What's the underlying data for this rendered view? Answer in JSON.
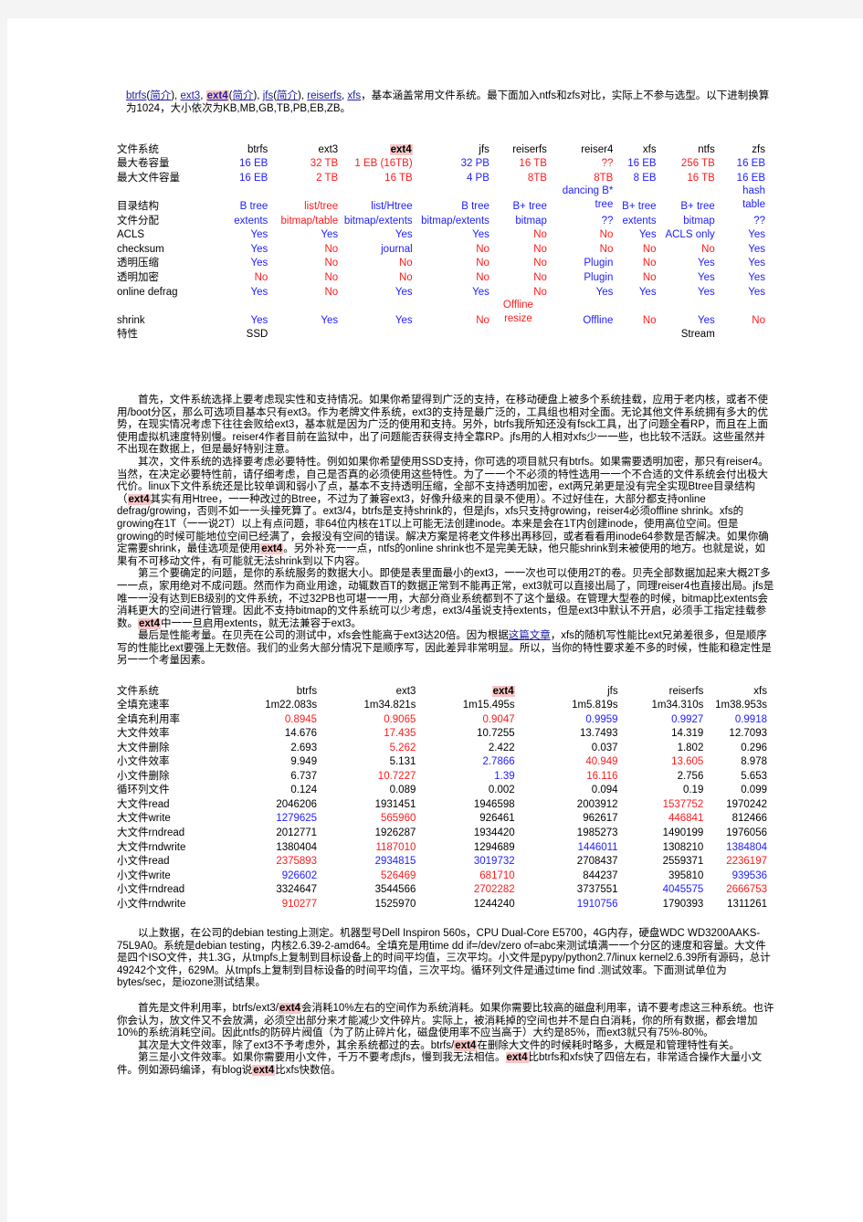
{
  "intro": {
    "links": [
      {
        "text": "btrfs",
        "kind": "link"
      },
      {
        "text": "(",
        "kind": "plain"
      },
      {
        "text": "简介",
        "kind": "link"
      },
      {
        "text": "), ",
        "kind": "plain"
      },
      {
        "text": "ext3",
        "kind": "link"
      },
      {
        "text": ", ",
        "kind": "plain"
      },
      {
        "text": "ext4",
        "kind": "link-hl"
      },
      {
        "text": "(",
        "kind": "plain"
      },
      {
        "text": "简介",
        "kind": "link"
      },
      {
        "text": "), ",
        "kind": "plain"
      },
      {
        "text": "jfs",
        "kind": "link"
      },
      {
        "text": "(",
        "kind": "plain"
      },
      {
        "text": "简介",
        "kind": "link"
      },
      {
        "text": "), ",
        "kind": "plain"
      },
      {
        "text": "reiserfs",
        "kind": "link"
      },
      {
        "text": ", ",
        "kind": "plain"
      },
      {
        "text": "xfs",
        "kind": "link"
      }
    ],
    "text": "，基本涵盖常用文件系统。最下面加入ntfs和zfs对比，实际上不参与选型。以下进制换算为1024，大小依次为KB,MB,GB,TB,PB,EB,ZB。"
  },
  "feature_table": {
    "header": [
      "文件系统",
      "btrfs",
      "ext3",
      "ext4",
      "jfs",
      "reiserfs",
      "reiser4",
      "xfs",
      "ntfs",
      "zfs"
    ],
    "rows": [
      {
        "label": "最大卷容量",
        "cells": [
          [
            "16 EB",
            "b"
          ],
          [
            "32 TB",
            "r"
          ],
          [
            "1 EB (16TB)",
            "r"
          ],
          [
            "32 PB",
            "b"
          ],
          [
            "16 TB",
            "r"
          ],
          [
            "??",
            "r"
          ],
          [
            "16 EB",
            "b"
          ],
          [
            "256 TB",
            "r"
          ],
          [
            "16 EB",
            "b"
          ]
        ]
      },
      {
        "label": "最大文件容量",
        "cells": [
          [
            "16 EB",
            "b"
          ],
          [
            "2 TB",
            "r"
          ],
          [
            "16 TB",
            "r"
          ],
          [
            "4 PB",
            "b"
          ],
          [
            "8TB",
            "r"
          ],
          [
            "8TB",
            "r"
          ],
          [
            "8 EB",
            "b"
          ],
          [
            "16 TB",
            "r"
          ],
          [
            "16 EB",
            "b"
          ]
        ]
      },
      {
        "label": "目录结构",
        "tall": true,
        "cells": [
          [
            "B tree",
            "b"
          ],
          [
            "list/tree",
            "r"
          ],
          [
            "list/Htree",
            "b"
          ],
          [
            "B tree",
            "b"
          ],
          [
            "B+ tree",
            "b"
          ],
          [
            "dancing B* tree",
            "b"
          ],
          [
            "B+ tree",
            "b"
          ],
          [
            "B+ tree",
            "b"
          ],
          [
            "hash table",
            "b"
          ]
        ]
      },
      {
        "label": "文件分配",
        "cells": [
          [
            "extents",
            "b"
          ],
          [
            "bitmap/table",
            "r"
          ],
          [
            "bitmap/extents",
            "b"
          ],
          [
            "bitmap/extents",
            "b"
          ],
          [
            "bitmap",
            "b"
          ],
          [
            "??",
            "b"
          ],
          [
            "extents",
            "b"
          ],
          [
            "bitmap",
            "b"
          ],
          [
            "??",
            "b"
          ]
        ]
      },
      {
        "label": "ACLS",
        "cells": [
          [
            "Yes",
            "b"
          ],
          [
            "Yes",
            "b"
          ],
          [
            "Yes",
            "b"
          ],
          [
            "Yes",
            "b"
          ],
          [
            "No",
            "r"
          ],
          [
            "No",
            "r"
          ],
          [
            "Yes",
            "b"
          ],
          [
            "ACLS only",
            "b"
          ],
          [
            "Yes",
            "b"
          ]
        ]
      },
      {
        "label": "checksum",
        "cells": [
          [
            "Yes",
            "b"
          ],
          [
            "No",
            "r"
          ],
          [
            "journal",
            "b"
          ],
          [
            "No",
            "r"
          ],
          [
            "No",
            "r"
          ],
          [
            "No",
            "r"
          ],
          [
            "No",
            "r"
          ],
          [
            "No",
            "r"
          ],
          [
            "Yes",
            "b"
          ]
        ]
      },
      {
        "label": "透明压缩",
        "cells": [
          [
            "Yes",
            "b"
          ],
          [
            "No",
            "r"
          ],
          [
            "No",
            "r"
          ],
          [
            "No",
            "r"
          ],
          [
            "No",
            "r"
          ],
          [
            "Plugin",
            "b"
          ],
          [
            "No",
            "r"
          ],
          [
            "Yes",
            "b"
          ],
          [
            "Yes",
            "b"
          ]
        ]
      },
      {
        "label": "透明加密",
        "cells": [
          [
            "No",
            "r"
          ],
          [
            "No",
            "r"
          ],
          [
            "No",
            "r"
          ],
          [
            "No",
            "r"
          ],
          [
            "No",
            "r"
          ],
          [
            "Plugin",
            "b"
          ],
          [
            "No",
            "r"
          ],
          [
            "Yes",
            "b"
          ],
          [
            "Yes",
            "b"
          ]
        ]
      },
      {
        "label": "online  defrag",
        "cells": [
          [
            "Yes",
            "b"
          ],
          [
            "No",
            "r"
          ],
          [
            "Yes",
            "b"
          ],
          [
            "Yes",
            "b"
          ],
          [
            "No",
            "r"
          ],
          [
            "Yes",
            "b"
          ],
          [
            "Yes",
            "b"
          ],
          [
            "Yes",
            "b"
          ],
          [
            "Yes",
            "b"
          ]
        ]
      },
      {
        "label": "shrink",
        "tall": true,
        "cells": [
          [
            "Yes",
            "b"
          ],
          [
            "Yes",
            "b"
          ],
          [
            "Yes",
            "b"
          ],
          [
            "No",
            "r"
          ],
          [
            "Offline resize",
            "r"
          ],
          [
            "Offline",
            "b"
          ],
          [
            "No",
            "r"
          ],
          [
            "Yes",
            "b"
          ],
          [
            "No",
            "r"
          ]
        ]
      },
      {
        "label": "特性",
        "cells": [
          [
            "SSD",
            "k"
          ],
          [
            "",
            ""
          ],
          [
            "",
            ""
          ],
          [
            "",
            ""
          ],
          [
            "",
            ""
          ],
          [
            "",
            ""
          ],
          [
            "",
            ""
          ],
          [
            "Stream",
            "k"
          ],
          [
            "",
            ""
          ]
        ]
      }
    ]
  },
  "paragraphs": [
    [
      {
        "t": "首先，文件系统选择上要考虑现实性和支持情况。如果你希望得到广泛的支持，在移动硬盘上被多个系统挂载，应用于老内核，或者不使用/boot分区，那么可选项目基本只有ext3。作为老牌文件系统，ext3的支持是最广泛的，工具组也相对全面。无论其他文件系统拥有多大的优势，在现实情况考虑下往往会败给ext3，基本就是因为广泛的使用和支持。另外，btrfs我所知还没有fsck工具，出了问题全看RP，而且在上面使用虚拟机速度特别慢。reiser4作者目前在监狱中，出了问题能否获得支持全靠RP。jfs用的人相对xfs少一一些，也比较不活跃。这些虽然并不出现在数据上，但是最好特别注意。"
      }
    ],
    [
      {
        "t": "其次，文件系统的选择要考虑必要特性。例如如果你希望使用SSD支持，你可选的项目就只有btrfs。如果需要透明加密，那只有reiser4。当然，在决定必要特性前，请仔细考虑，自己是否真的必须使用这些特性。为了一一个不必须的特性选用一一个不合适的文件系统会付出极大代价。linux下文件系统还是比较单调和弱小了点，基本不支持透明压缩，全部不支持透明加密，ext两兄弟更是没有完全实现Btree目录结构（"
      },
      {
        "t": "ext4",
        "hl": true
      },
      {
        "t": "其实有用Htree，一一种改过的Btree，不过为了兼容ext3，好像升级来的目录不使用）。不过好佳在，大部分都支持online  defrag/growing，否则不如一一头撞死算了。ext3/4，btrfs是支持shrink的，但是jfs，xfs只支持growing，reiser4必须offline  shrink。xfs的growing在1T（一一说2T）以上有点问题，非64位内核在1T以上可能无法创建inode。本来是会在1T内创建inode，使用高位空间。但是growing的时候可能地位空间已经满了，会报没有空间的错误。解决方案是将老文件移出再移回，或者看看用inode64参数是否解决。如果你确定需要shrink，最佳选项是使用"
      },
      {
        "t": "ext4",
        "hl": true
      },
      {
        "t": "。另外补充一一点，ntfs的online  shrink也不是完美无缺，他只能shrink到未被使用的地方。也就是说，如果有不可移动文件，有可能就无法shrink到以下内容。"
      }
    ],
    [
      {
        "t": "第三个要确定的问题，是你的系统服务的数据大小。即使是表里面最小的ext3，一一次也可以使用2T的卷。贝壳全部数据加起来大概2T多一一点，家用绝对不成问题。然而作为商业用途，动辄数百T的数据正常到不能再正常，ext3就可以直接出局了，同理reiser4也直接出局。jfs是唯一一没有达到EB级别的文件系统，不过32PB也可堪一一用，大部分商业系统都到不了这个量级。在管理大型卷的时候，bitmap比extents会消耗更大的空间进行管理。因此不支持bitmap的文件系统可以少考虑，ext3/4虽说支持extents，但是ext3中默认不开启，必须手工指定挂载参数。"
      },
      {
        "t": "ext4",
        "hl": true
      },
      {
        "t": "中一一旦启用extents，就无法兼容于ext3。"
      }
    ],
    [
      {
        "t": "最后是性能考量。在贝壳在公司的测试中，xfs会性能高于ext3达20倍。因为根据"
      },
      {
        "t": "这篇文章",
        "link": true
      },
      {
        "t": "，xfs的随机写性能比ext兄弟差很多，但是顺序写的性能比ext要强上无数倍。我们的业务大部分情况下是顺序写，因此差异非常明显。所以，当你的特性要求差不多的时候，性能和稳定性是另一一个考量因素。"
      }
    ]
  ],
  "perf_table": {
    "header": [
      "文件系统",
      "btrfs",
      "ext3",
      "ext4",
      "jfs",
      "reiserfs",
      "xfs"
    ],
    "rows": [
      {
        "label": "全填充速率",
        "cells": [
          [
            "1m22.083s",
            "k"
          ],
          [
            "1m34.821s",
            "k"
          ],
          [
            "1m15.495s",
            "k"
          ],
          [
            "1m5.819s",
            "k"
          ],
          [
            "1m34.310s",
            "k"
          ],
          [
            "1m38.953s",
            "k"
          ]
        ]
      },
      {
        "label": "全填充利用率",
        "cells": [
          [
            "0.8945",
            "r"
          ],
          [
            "0.9065",
            "r"
          ],
          [
            "0.9047",
            "r"
          ],
          [
            "0.9959",
            "b"
          ],
          [
            "0.9927",
            "b"
          ],
          [
            "0.9918",
            "b"
          ]
        ]
      },
      {
        "label": "大文件效率",
        "cells": [
          [
            "14.676",
            "k"
          ],
          [
            "17.435",
            "r"
          ],
          [
            "10.7255",
            "k"
          ],
          [
            "13.7493",
            "k"
          ],
          [
            "14.319",
            "k"
          ],
          [
            "12.7093",
            "k"
          ]
        ]
      },
      {
        "label": "大文件删除",
        "cells": [
          [
            "2.693",
            "k"
          ],
          [
            "5.262",
            "r"
          ],
          [
            "2.422",
            "k"
          ],
          [
            "0.037",
            "k"
          ],
          [
            "1.802",
            "k"
          ],
          [
            "0.296",
            "k"
          ]
        ]
      },
      {
        "label": "小文件效率",
        "cells": [
          [
            "9.949",
            "k"
          ],
          [
            "5.131",
            "k"
          ],
          [
            "2.7866",
            "b"
          ],
          [
            "40.949",
            "r"
          ],
          [
            "13.605",
            "r"
          ],
          [
            "8.978",
            "k"
          ]
        ]
      },
      {
        "label": "小文件删除",
        "cells": [
          [
            "6.737",
            "k"
          ],
          [
            "10.7227",
            "r"
          ],
          [
            "1.39",
            "b"
          ],
          [
            "16.116",
            "r"
          ],
          [
            "2.756",
            "k"
          ],
          [
            "5.653",
            "k"
          ]
        ]
      },
      {
        "label": "循环列文件",
        "cells": [
          [
            "0.124",
            "k"
          ],
          [
            "0.089",
            "k"
          ],
          [
            "0.002",
            "k"
          ],
          [
            "0.094",
            "k"
          ],
          [
            "0.19",
            "k"
          ],
          [
            "0.099",
            "k"
          ]
        ]
      },
      {
        "label": "大文件read",
        "cells": [
          [
            "2046206",
            "k"
          ],
          [
            "1931451",
            "k"
          ],
          [
            "1946598",
            "k"
          ],
          [
            "2003912",
            "k"
          ],
          [
            "1537752",
            "r"
          ],
          [
            "1970242",
            "k"
          ]
        ]
      },
      {
        "label": "大文件write",
        "cells": [
          [
            "1279625",
            "b"
          ],
          [
            "565960",
            "r"
          ],
          [
            "926461",
            "k"
          ],
          [
            "962617",
            "k"
          ],
          [
            "446841",
            "r"
          ],
          [
            "812466",
            "k"
          ]
        ]
      },
      {
        "label": "大文件rndread",
        "cells": [
          [
            "2012771",
            "k"
          ],
          [
            "1926287",
            "k"
          ],
          [
            "1934420",
            "k"
          ],
          [
            "1985273",
            "k"
          ],
          [
            "1490199",
            "k"
          ],
          [
            "1976056",
            "k"
          ]
        ]
      },
      {
        "label": "大文件rndwrite",
        "cells": [
          [
            "1380404",
            "k"
          ],
          [
            "1187010",
            "r"
          ],
          [
            "1294689",
            "k"
          ],
          [
            "1446011",
            "b"
          ],
          [
            "1308210",
            "k"
          ],
          [
            "1384804",
            "b"
          ]
        ]
      },
      {
        "label": "小文件read",
        "cells": [
          [
            "2375893",
            "r"
          ],
          [
            "2934815",
            "b"
          ],
          [
            "3019732",
            "b"
          ],
          [
            "2708437",
            "k"
          ],
          [
            "2559371",
            "k"
          ],
          [
            "2236197",
            "r"
          ]
        ]
      },
      {
        "label": "小文件write",
        "cells": [
          [
            "926602",
            "b"
          ],
          [
            "526469",
            "r"
          ],
          [
            "681710",
            "r"
          ],
          [
            "844237",
            "k"
          ],
          [
            "395810",
            "k"
          ],
          [
            "939536",
            "b"
          ]
        ]
      },
      {
        "label": "小文件rndread",
        "cells": [
          [
            "3324647",
            "k"
          ],
          [
            "3544566",
            "k"
          ],
          [
            "2702282",
            "r"
          ],
          [
            "3737551",
            "k"
          ],
          [
            "4045575",
            "b"
          ],
          [
            "2666753",
            "r"
          ]
        ]
      },
      {
        "label": "小文件rndwrite",
        "cells": [
          [
            "910277",
            "r"
          ],
          [
            "1525970",
            "k"
          ],
          [
            "1244240",
            "k"
          ],
          [
            "1910756",
            "b"
          ],
          [
            "1790393",
            "k"
          ],
          [
            "1311261",
            "k"
          ]
        ]
      }
    ]
  },
  "after_paragraphs": [
    [
      {
        "t": "以上数据，在公司的debian  testing上测定。机器型号Dell  Inspiron  560s，CPU  Dual-Core  E5700，4G内存，硬盘WDC  WD3200AAKS-75L9A0。系统是debian  testing，内核2.6.39-2-amd64。全填充是用time  dd  if=/dev/zero  of=abc来测试填满一一个分区的速度和容量。大文件是四个ISO文件，共1.3G，从tmpfs上复制到目标设备上的时间平均值，三次平均。小文件是pypy/python2.7/linux  kernel2.6.39所有源码，总计49242个文件，629M。从tmpfs上复制到目标设备的时间平均值，三次平均。循环列文件是通过time  find  .测试效率。下面测试单位为bytes/sec，是iozone测试结果。"
      }
    ],
    [
      {
        "t": "首先是文件利用率，btrfs/ext3/"
      },
      {
        "t": "ext4",
        "hl": true
      },
      {
        "t": "会消耗10%左右的空间作为系统消耗。如果你需要比较高的磁盘利用率，请不要考虑这三种系统。也许你会认为，放文件又不会放满，必须空出部分来才能减少文件碎片。实际上，被消耗掉的空间也并不是白白消耗，你的所有数据，都会增加10%的系统消耗空间。因此ntfs的防碎片阀值（为了防止碎片化，磁盘使用率不应当高于）大约是85%，而ext3就只有75%-80%。"
      }
    ],
    [
      {
        "t": "其次是大文件效率，除了ext3不予考虑外，其余系统都过的去。btrfs/"
      },
      {
        "t": "ext4",
        "hl": true
      },
      {
        "t": "在删除大文件的时候耗时略多，大概是和管理特性有关。"
      }
    ],
    [
      {
        "t": "第三是小文件效率。如果你需要用小文件，千万不要考虑jfs，慢到我无法相信。"
      },
      {
        "t": "ext4",
        "hl": true
      },
      {
        "t": "比btrfs和xfs快了四倍左右，非常适合操作大量小文件。例如源码编译，有blog说"
      },
      {
        "t": "ext4",
        "hl": true
      },
      {
        "t": "比xfs快数倍。"
      }
    ]
  ],
  "colors": {
    "good": "#2020ff",
    "bad": "#ff1a1a",
    "link": "#1a1aa6",
    "highlight": "#f7c6c6",
    "page_bg": "#ffffff",
    "frame_bg": "#f4f4f4"
  }
}
